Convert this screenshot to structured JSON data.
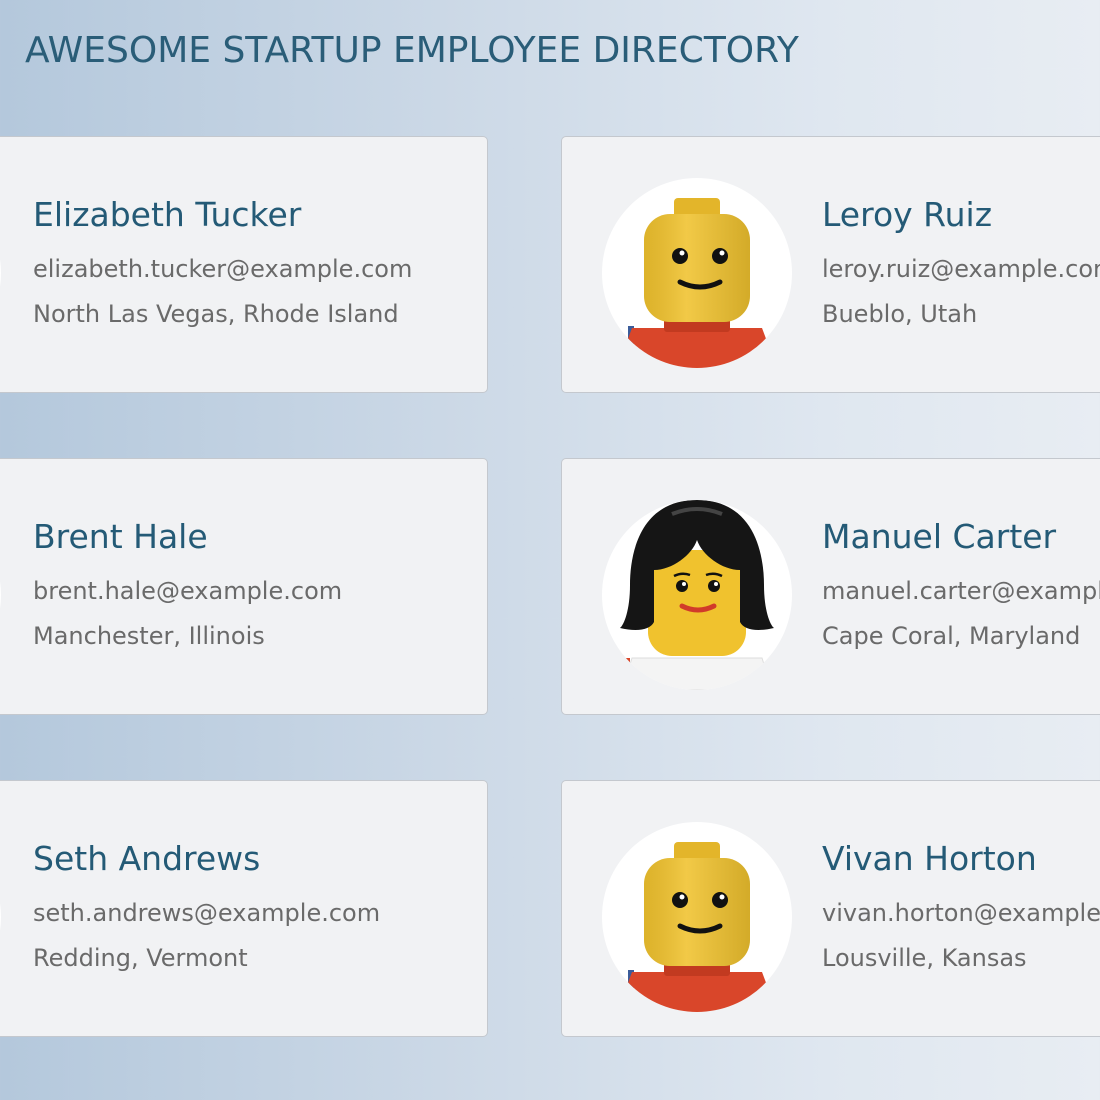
{
  "page": {
    "title": "AWESOME STARTUP EMPLOYEE DIRECTORY"
  },
  "employees": [
    {
      "name": "Elizabeth Tucker",
      "email": "elizabeth.tucker@example.com",
      "location": "North Las Vegas, Rhode Island",
      "avatar_icon": "lego-minifig-avatar-icon"
    },
    {
      "name": "Leroy Ruiz",
      "email": "leroy.ruiz@example.com",
      "location": "Bueblo, Utah",
      "avatar_icon": "lego-minifig-avatar-icon"
    },
    {
      "name": "Brent Hale",
      "email": "brent.hale@example.com",
      "location": "Manchester, Illinois",
      "avatar_icon": "lego-minifig-avatar-icon"
    },
    {
      "name": "Manuel Carter",
      "email": "manuel.carter@example.com",
      "location": "Cape Coral, Maryland",
      "avatar_icon": "lego-minifig-hair-avatar-icon"
    },
    {
      "name": "Seth Andrews",
      "email": "seth.andrews@example.com",
      "location": "Redding, Vermont",
      "avatar_icon": "lego-minifig-avatar-icon"
    },
    {
      "name": "Vivan Horton",
      "email": "vivan.horton@example.com",
      "location": "Lousville, Kansas",
      "avatar_icon": "lego-minifig-avatar-icon"
    }
  ],
  "colors": {
    "title": "#2a5d78",
    "name": "#245a76",
    "secondary_text": "#6a6a6a",
    "card_background": "#f1f2f4",
    "card_border": "#c4c8ce"
  }
}
